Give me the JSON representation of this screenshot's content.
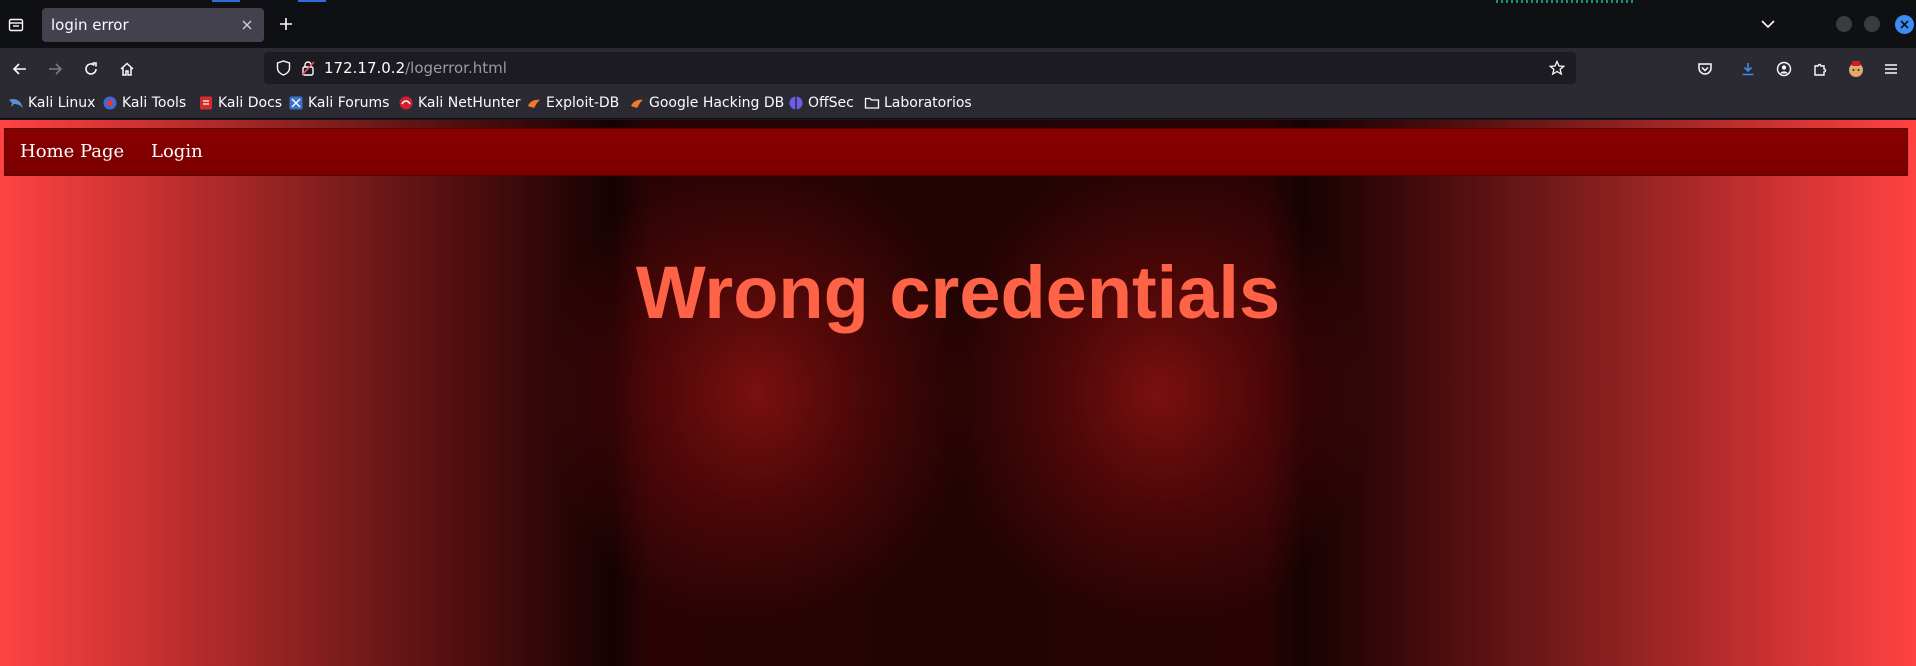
{
  "browser": {
    "tab": {
      "title": "login error"
    },
    "url": {
      "host": "172.17.0.2",
      "path": "/logerror.html"
    },
    "bookmarks": [
      {
        "label": "Kali Linux",
        "icon": "kali-dragon-icon"
      },
      {
        "label": "Kali Tools",
        "icon": "kali-tools-icon"
      },
      {
        "label": "Kali Docs",
        "icon": "kali-docs-icon"
      },
      {
        "label": "Kali Forums",
        "icon": "kali-forums-icon"
      },
      {
        "label": "Kali NetHunter",
        "icon": "kali-nethunter-icon"
      },
      {
        "label": "Exploit-DB",
        "icon": "exploit-db-icon"
      },
      {
        "label": "Google Hacking DB",
        "icon": "ghdb-icon"
      },
      {
        "label": "OffSec",
        "icon": "offsec-icon"
      },
      {
        "label": "Laboratorios",
        "icon": "folder-icon"
      }
    ],
    "colors": {
      "accent": "#2a6fd8",
      "tab_active": "#42414d",
      "toolbar": "#2b2a33"
    }
  },
  "site": {
    "nav": [
      {
        "label": "Home Page"
      },
      {
        "label": "Login"
      }
    ],
    "heading": "Wrong credentials",
    "colors": {
      "nav_bg": "#8a0000",
      "heading": "#ff6347",
      "edge": "#ff4343",
      "center": "#220404"
    }
  }
}
